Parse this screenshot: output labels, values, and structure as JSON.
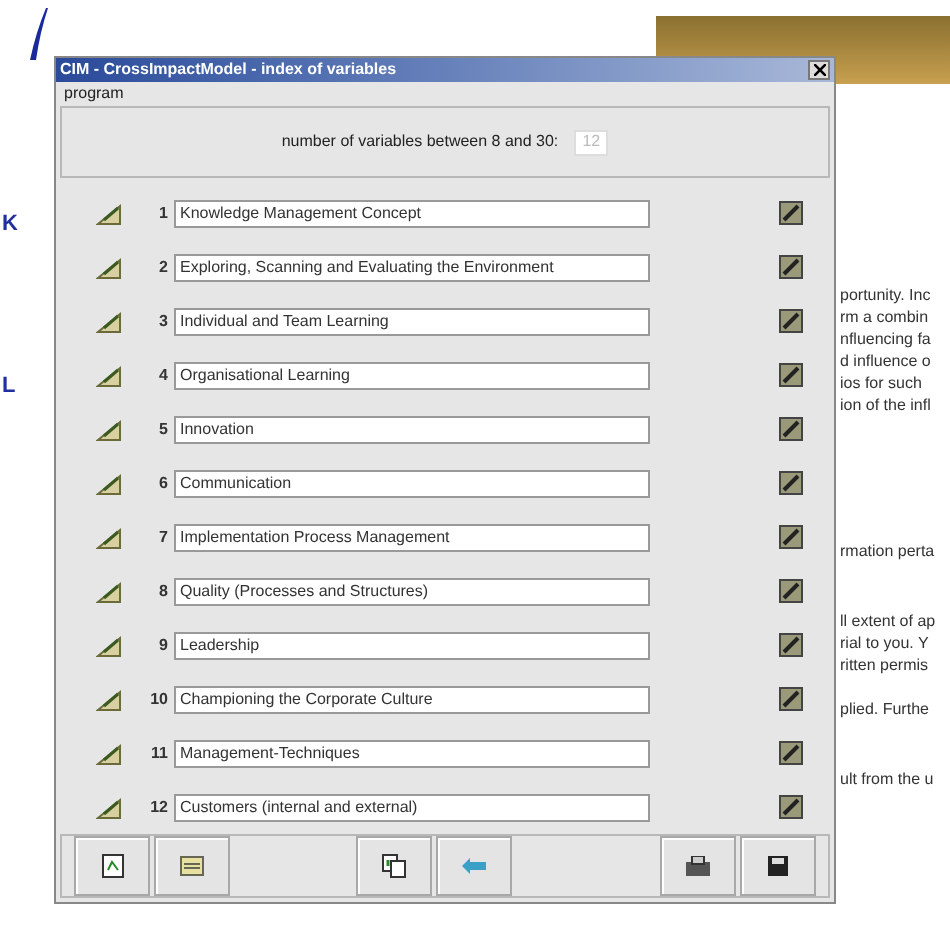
{
  "window": {
    "title": "CIM - CrossImpactModel - index of variables"
  },
  "menu": [
    "program"
  ],
  "count": {
    "label": "number of variables between 8 and 30:",
    "value": "12"
  },
  "variables": [
    {
      "number": "1",
      "name": "Knowledge Management Concept"
    },
    {
      "number": "2",
      "name": "Exploring, Scanning and Evaluating the Environment"
    },
    {
      "number": "3",
      "name": "Individual and Team Learning"
    },
    {
      "number": "4",
      "name": "Organisational Learning"
    },
    {
      "number": "5",
      "name": "Innovation"
    },
    {
      "number": "6",
      "name": "Communication"
    },
    {
      "number": "7",
      "name": "Implementation Process Management"
    },
    {
      "number": "8",
      "name": "Quality (Processes and Structures)"
    },
    {
      "number": "9",
      "name": "Leadership"
    },
    {
      "number": "10",
      "name": "Championing the Corporate Culture"
    },
    {
      "number": "11",
      "name": "Management-Techniques"
    },
    {
      "number": "12",
      "name": "Customers (internal and external)"
    }
  ],
  "background_left": [
    "K",
    "L"
  ],
  "background_right": [
    [
      "portunity. Inc",
      "rm a combin",
      "nfluencing fa",
      "d influence o",
      "ios for such",
      "ion of the infl"
    ],
    [
      "rmation perta"
    ],
    [
      "ll extent of ap",
      "rial to you. Y",
      "ritten permis"
    ],
    [
      "plied. Furthe"
    ],
    [
      "ult from the u"
    ]
  ]
}
